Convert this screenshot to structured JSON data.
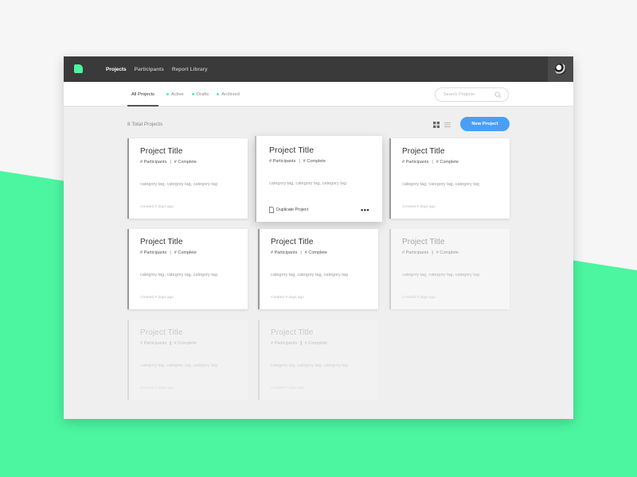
{
  "colors": {
    "accent": "#4cf5a0",
    "primary_button": "#4a9ff5",
    "topbar": "#3a3a3a"
  },
  "topnav": {
    "items": [
      {
        "label": "Projects",
        "active": true
      },
      {
        "label": "Participants",
        "active": false
      },
      {
        "label": "Report Library",
        "active": false
      }
    ]
  },
  "tabs": [
    {
      "label": "All Projects",
      "active": true
    },
    {
      "label": "Active",
      "active": false
    },
    {
      "label": "Drafts",
      "active": false
    },
    {
      "label": "Archived",
      "active": false
    }
  ],
  "search": {
    "placeholder": "Search Projects",
    "value": ""
  },
  "toolbar": {
    "count_label": "8 Total Projects",
    "new_button": "New Project"
  },
  "cards": [
    {
      "title": "Project Title",
      "participants": "# Participants",
      "sep": "|",
      "complete": "# Complete",
      "tags": "category tag, category tag, category tag",
      "created": "Created # days ago"
    },
    {
      "title": "Project Title",
      "participants": "# Participants",
      "sep": "|",
      "complete": "# Complete",
      "tags": "category tag, category tag, category tag",
      "created": "",
      "action": "Duplicate Project",
      "more": "•••"
    },
    {
      "title": "Project Title",
      "participants": "# Participants",
      "sep": "|",
      "complete": "# Complete",
      "tags": "category tag, category tag, category tag",
      "created": "Created # days ago"
    },
    {
      "title": "Project Title",
      "participants": "# Participants",
      "sep": "|",
      "complete": "# Complete",
      "tags": "category tag, category tag, category tag",
      "created": "Created # days ago"
    },
    {
      "title": "Project Title",
      "participants": "# Participants",
      "sep": "|",
      "complete": "# Complete",
      "tags": "category tag, category tag, category tag",
      "created": "Created # days ago"
    },
    {
      "title": "Project Title",
      "participants": "# Participants",
      "sep": "|",
      "complete": "# Complete",
      "tags": "category tag, category tag, category tag",
      "created": "Created # days ago"
    },
    {
      "title": "Project Title",
      "participants": "# Participants",
      "sep": "|",
      "complete": "# Complete",
      "tags": "category tag, category tag, category tag",
      "created": "Created # days ago"
    },
    {
      "title": "Project Title",
      "participants": "# Participants",
      "sep": "|",
      "complete": "# Complete",
      "tags": "category tag, category tag, category tag",
      "created": "Created # days ago"
    }
  ]
}
